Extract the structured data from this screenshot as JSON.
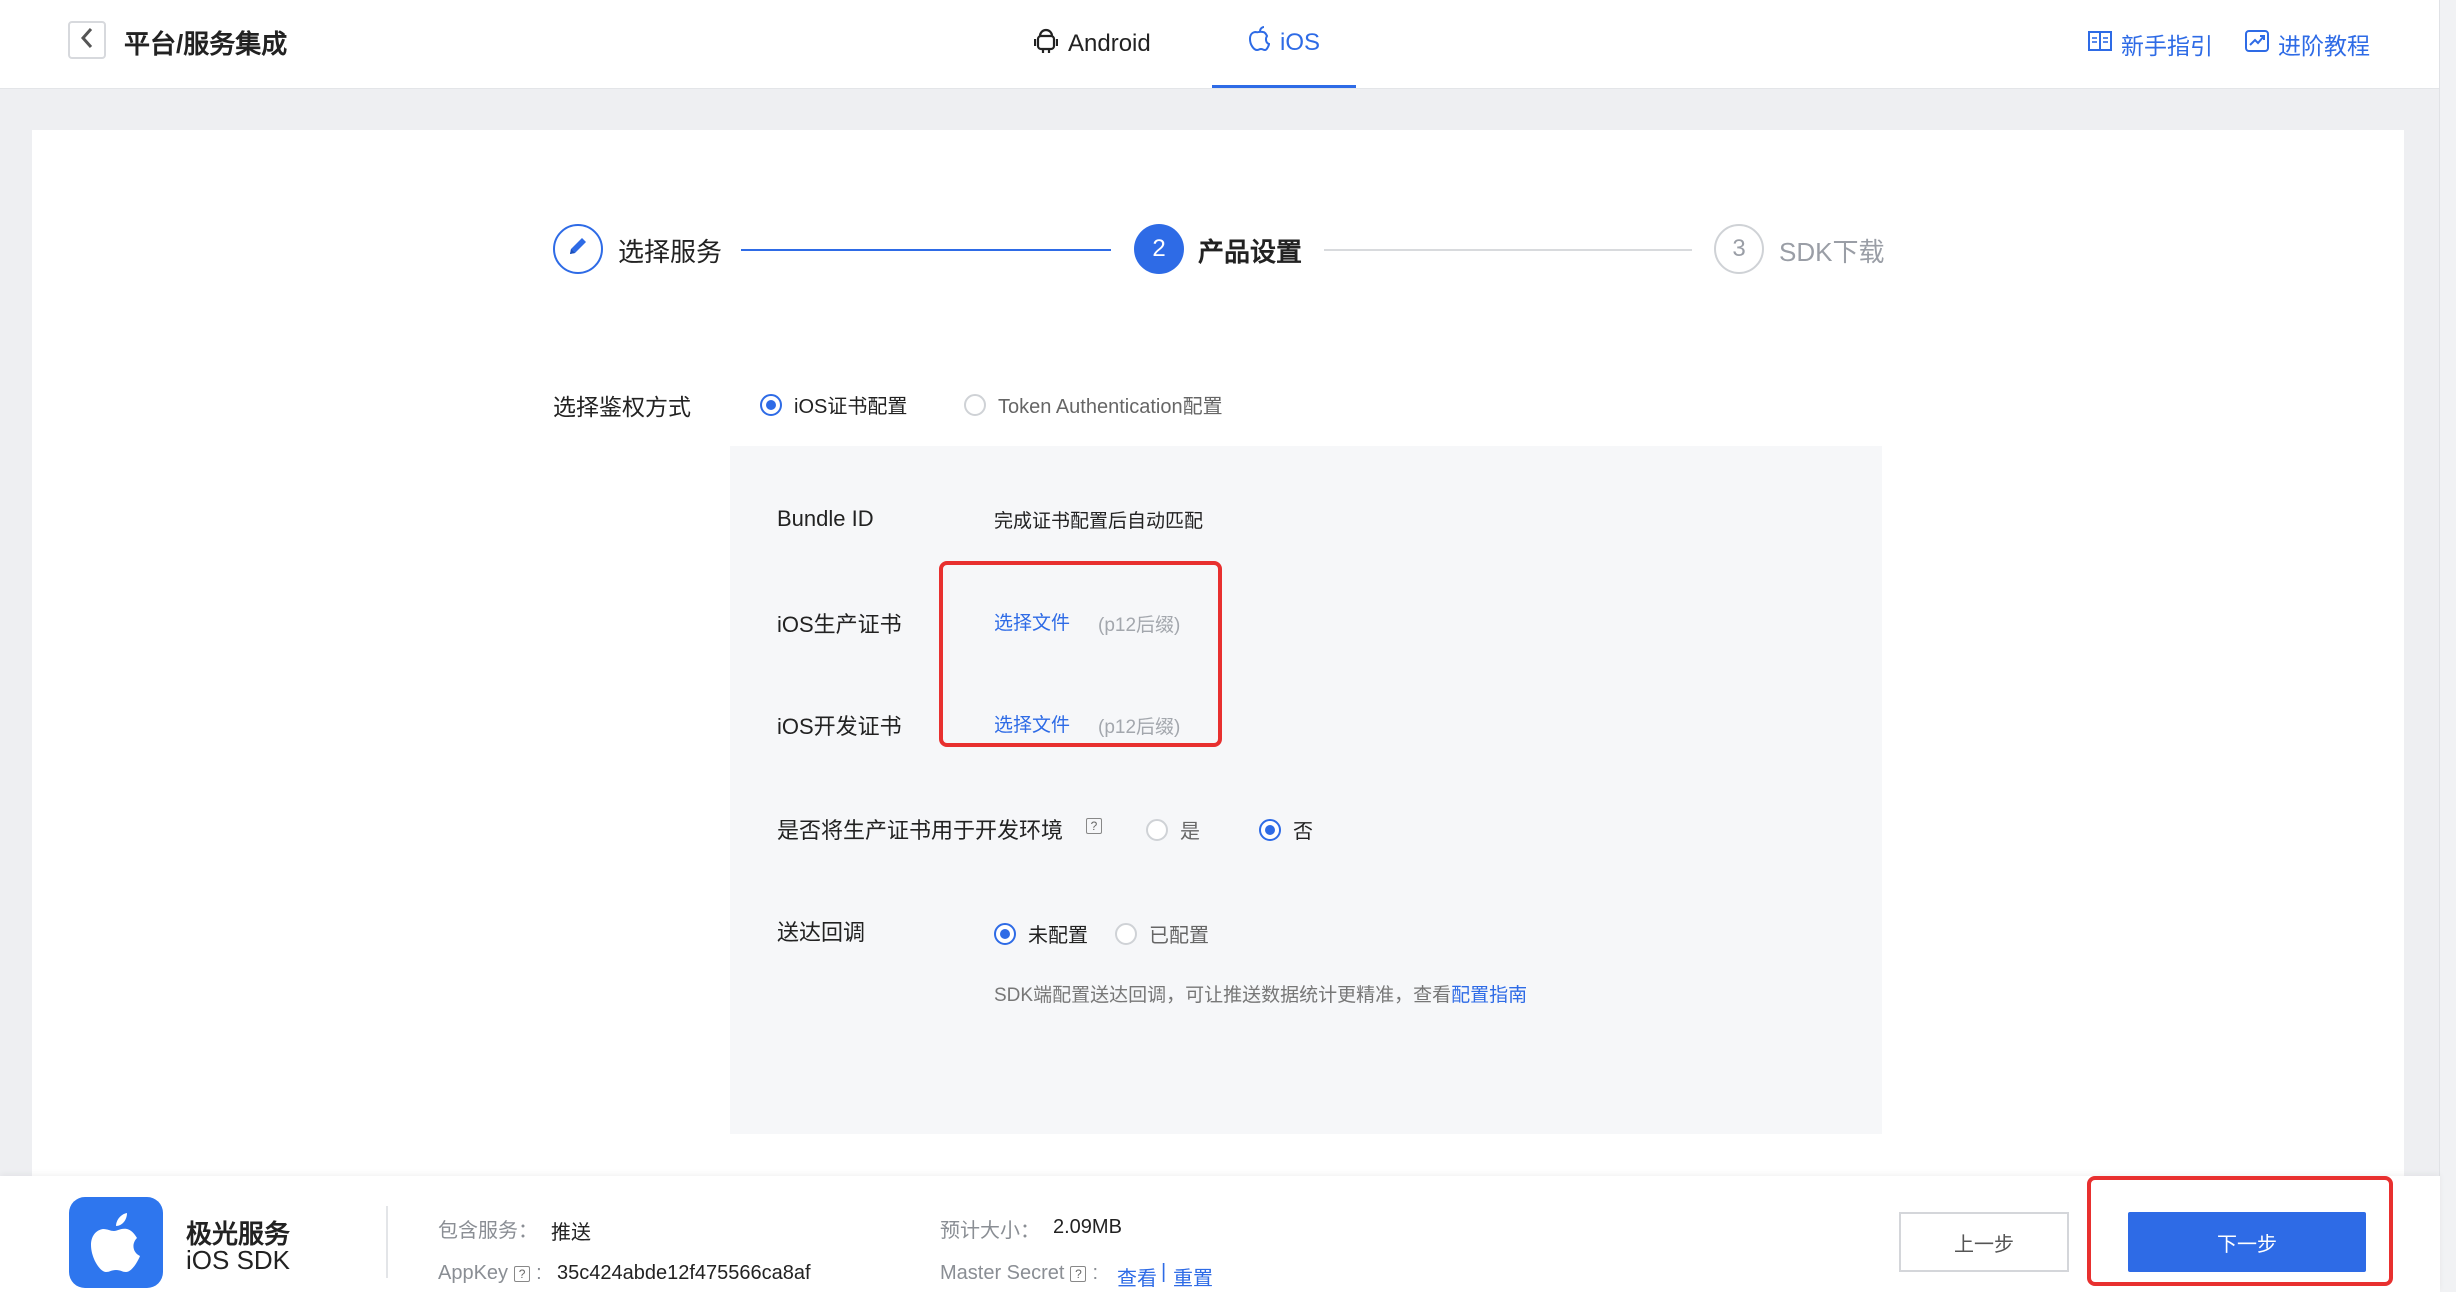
{
  "header": {
    "title": "平台/服务集成",
    "tabs": [
      {
        "label": "Android",
        "icon": "android-icon"
      },
      {
        "label": "iOS",
        "icon": "apple-icon",
        "active": true
      }
    ],
    "links": [
      {
        "label": "新手指引",
        "icon": "book-icon"
      },
      {
        "label": "进阶教程",
        "icon": "trend-chart-icon"
      }
    ]
  },
  "steps": [
    {
      "number": "",
      "label": "选择服务",
      "state": "done"
    },
    {
      "number": "2",
      "label": "产品设置",
      "state": "active"
    },
    {
      "number": "3",
      "label": "SDK下载",
      "state": "todo"
    }
  ],
  "auth": {
    "label": "选择鉴权方式",
    "options": [
      {
        "label": "iOS证书配置",
        "selected": true
      },
      {
        "label": "Token Authentication配置",
        "selected": false
      }
    ]
  },
  "form": {
    "bundle_id": {
      "label": "Bundle ID",
      "value": "完成证书配置后自动匹配"
    },
    "prod_cert": {
      "label": "iOS生产证书",
      "link": "选择文件",
      "hint": "(p12后缀)"
    },
    "dev_cert": {
      "label": "iOS开发证书",
      "link": "选择文件",
      "hint": "(p12后缀)"
    },
    "use_prod_for_dev": {
      "label": "是否将生产证书用于开发环境",
      "help": "?",
      "options": [
        {
          "label": "是",
          "selected": false
        },
        {
          "label": "否",
          "selected": true
        }
      ]
    },
    "delivery_callback": {
      "label": "送达回调",
      "options": [
        {
          "label": "未配置",
          "selected": true
        },
        {
          "label": "已配置",
          "selected": false
        }
      ],
      "note": "SDK端配置送达回调，可让推送数据统计更精准，查看",
      "note_link": "配置指南"
    }
  },
  "footer": {
    "app_name": "极光服务",
    "app_sub": "iOS SDK",
    "service_label": "包含服务：",
    "service_value": "推送",
    "appkey_label": "AppKey",
    "appkey_value": "35c424abde12f475566ca8af",
    "size_label": "预计大小：",
    "size_value": "2.09MB",
    "secret_label": "Master Secret",
    "secret_view": "查看",
    "secret_sep": "|",
    "secret_reset": "重置",
    "help": "?",
    "colon": ":",
    "prev_label": "上一步",
    "next_label": "下一步"
  },
  "colors": {
    "accent": "#2e6be6",
    "highlight": "#e8302f"
  }
}
